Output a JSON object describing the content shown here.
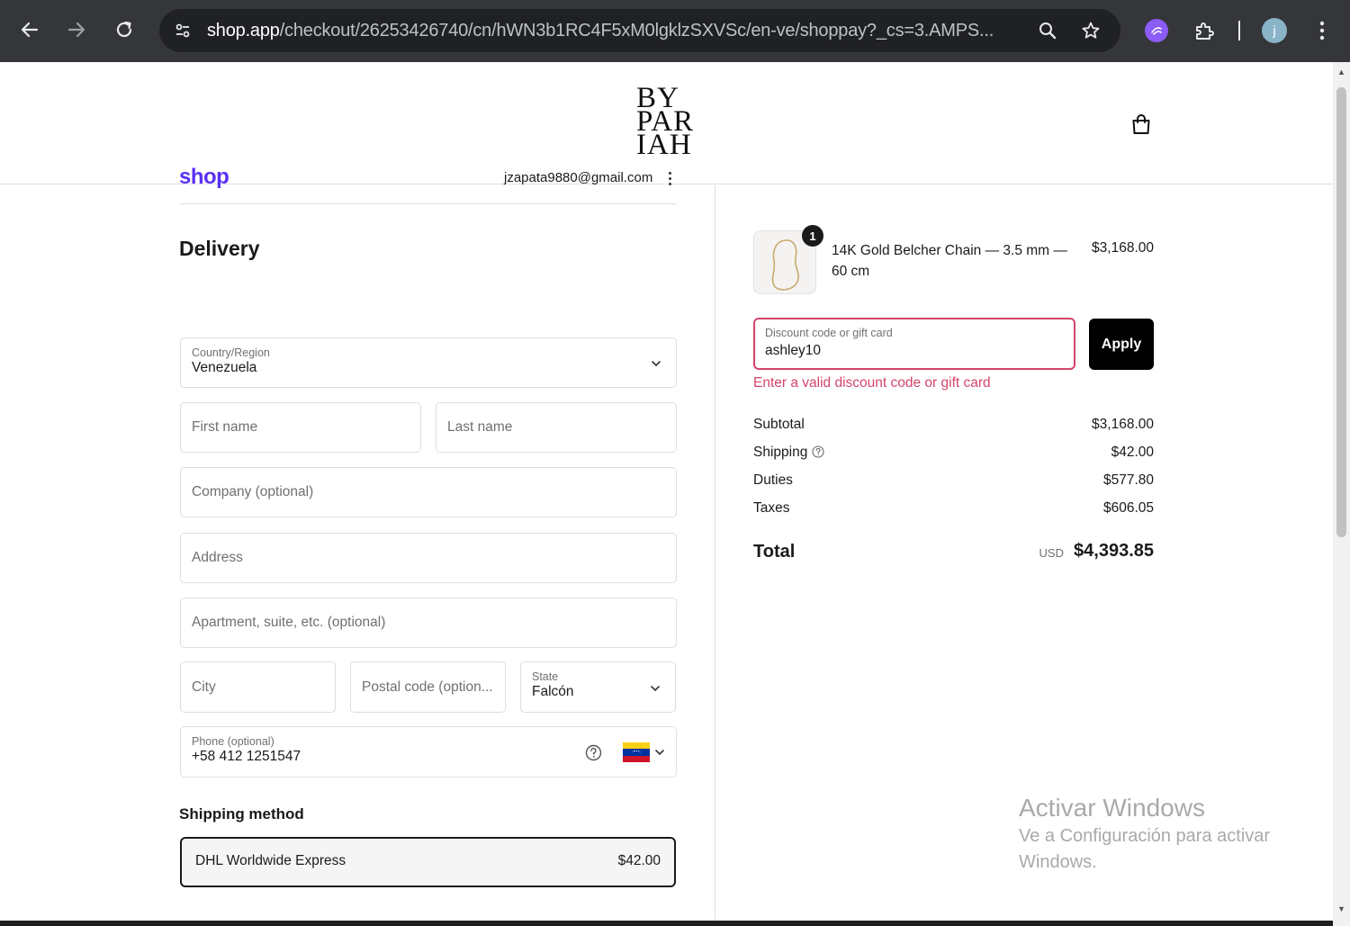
{
  "browser": {
    "url_host": "shop.app",
    "url_path": "/checkout/26253426740/cn/hWN3b1RC4F5xM0lgklzSXVSc/en-ve/shoppay?_cs=3.AMPS...",
    "profile_initial": "j"
  },
  "store": {
    "logo_lines": [
      "BY",
      "PAR",
      "IAH"
    ]
  },
  "account": {
    "shop_logo": "shop",
    "email": "jzapata9880@gmail.com"
  },
  "delivery": {
    "heading": "Delivery",
    "country_label": "Country/Region",
    "country_value": "Venezuela",
    "first_name_placeholder": "First name",
    "last_name_placeholder": "Last name",
    "company_placeholder": "Company (optional)",
    "address_placeholder": "Address",
    "apartment_placeholder": "Apartment, suite, etc. (optional)",
    "city_placeholder": "City",
    "postal_placeholder": "Postal code (option...",
    "state_label": "State",
    "state_value": "Falcón",
    "phone_label": "Phone (optional)",
    "phone_value": "+58 412 1251547"
  },
  "shipping_method": {
    "heading": "Shipping method",
    "option_name": "DHL Worldwide Express",
    "option_price": "$42.00"
  },
  "order": {
    "item": {
      "quantity": "1",
      "name": "14K Gold Belcher Chain — 3.5 mm — 60 cm",
      "price": "$3,168.00"
    },
    "discount": {
      "label": "Discount code or gift card",
      "value": "ashley10",
      "apply_label": "Apply",
      "error": "Enter a valid discount code or gift card"
    },
    "summary": {
      "subtotal_label": "Subtotal",
      "subtotal_value": "$3,168.00",
      "shipping_label": "Shipping",
      "shipping_value": "$42.00",
      "duties_label": "Duties",
      "duties_value": "$577.80",
      "taxes_label": "Taxes",
      "taxes_value": "$606.05",
      "total_label": "Total",
      "currency": "USD",
      "total_value": "$4,393.85"
    }
  },
  "os_watermark": {
    "line1": "Activar Windows",
    "line2": "Ve a Configuración para activar Windows."
  },
  "colors": {
    "chrome_bg": "#35363a",
    "omnibox_bg": "#202124",
    "shop_brand": "#5a31f4",
    "error": "#d4456b",
    "primary_button": "#000000"
  },
  "icons": [
    "back-arrow-icon",
    "forward-arrow-icon",
    "reload-icon",
    "site-settings-icon",
    "zoom-icon",
    "bookmark-star-icon",
    "extension-icon",
    "puzzle-icon",
    "profile-avatar",
    "menu-kebab-icon",
    "bag-icon",
    "chevron-down-icon",
    "help-circle-icon",
    "venezuela-flag-icon"
  ]
}
